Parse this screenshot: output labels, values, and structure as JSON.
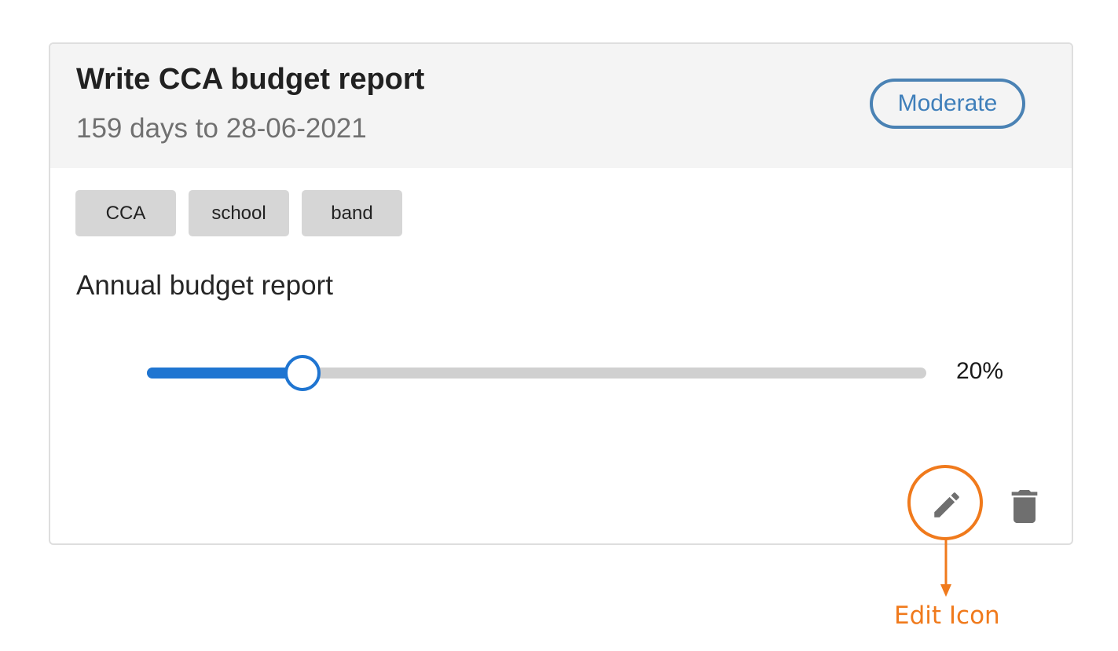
{
  "task": {
    "title": "Write CCA budget report",
    "due": "159 days to 28-06-2021",
    "priority": "Moderate",
    "tags": [
      "CCA",
      "school",
      "band"
    ],
    "description": "Annual budget report",
    "progress": 0.2,
    "progress_label": "20%"
  },
  "actions": {
    "edit_icon": "pencil-icon",
    "delete_icon": "trash-icon"
  },
  "annotation": {
    "label": "Edit Icon"
  },
  "colors": {
    "accent": "#1f75d1",
    "badge": "#3f7fba",
    "annotation": "#f07a1c",
    "icon": "#6f6f6f"
  }
}
